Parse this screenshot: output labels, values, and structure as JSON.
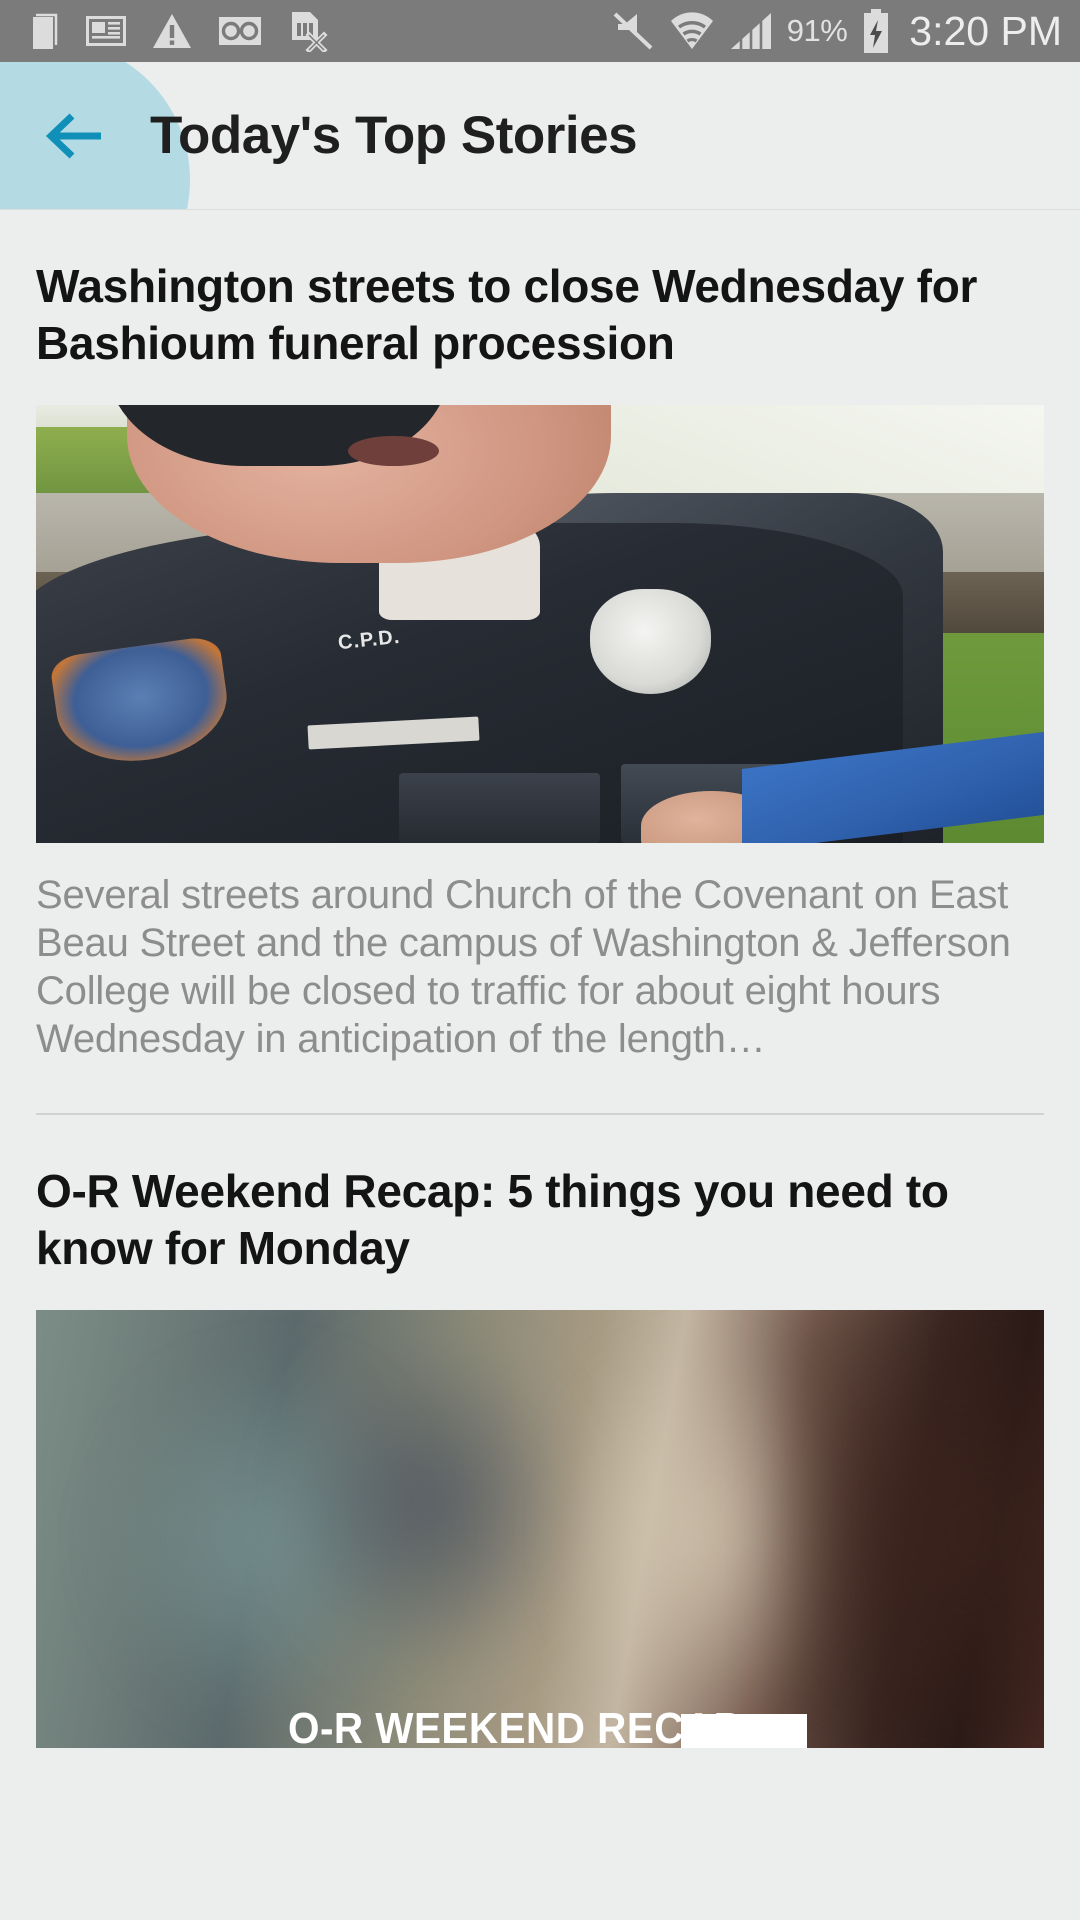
{
  "status_bar": {
    "icons_left": [
      "sim-card-icon",
      "news-icon",
      "warning-icon",
      "voicemail-icon",
      "sim-removed-icon"
    ],
    "icons_right": [
      "mute-icon",
      "wifi-icon",
      "cellular-signal-icon"
    ],
    "battery_percent": "91%",
    "battery_icon": "battery-charging-icon",
    "clock": "3:20 PM",
    "background_color": "#7b7b7b",
    "text_color": "#e8e8e8"
  },
  "app_bar": {
    "back_icon": "arrow-left-icon",
    "back_icon_color": "#1090b8",
    "ripple_color": "#b4dbe4",
    "title": "Today's Top Stories",
    "background_color": "#eceeed"
  },
  "articles": [
    {
      "headline": "Washington streets to close Wednesday for Bashioum funeral procession",
      "image_alt": "police-officer-photo",
      "summary": "Several streets around Church of the Covenant on East Beau Street and the campus of Washington & Jefferson College will be closed to traffic for about eight hours Wednesday in anticipation of the length…",
      "summary_color": "#8d8d8d",
      "headline_color": "#141414"
    },
    {
      "headline": "O-R Weekend Recap: 5 things you need to know for Monday",
      "image_alt": "or-weekend-recap-video-thumbnail",
      "image_caption": "O-R WEEKEND RECAP",
      "headline_color": "#141414"
    }
  ],
  "colors": {
    "page_background": "#eceeed",
    "divider": "#d2d2d2",
    "accent": "#1090b8"
  }
}
